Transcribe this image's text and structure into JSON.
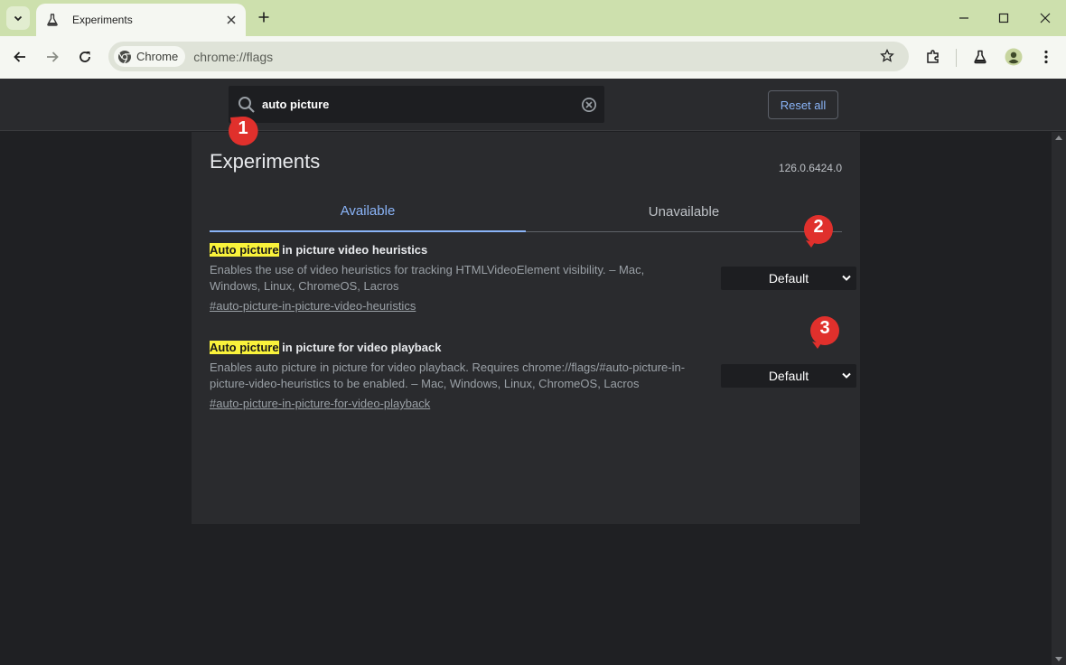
{
  "browser": {
    "tab_title": "Experiments",
    "chip_label": "Chrome",
    "url": "chrome://flags"
  },
  "flags_page": {
    "search_value": "auto picture",
    "reset_label": "Reset all",
    "title": "Experiments",
    "version": "126.0.6424.0",
    "tabs": [
      {
        "label": "Available",
        "active": true
      },
      {
        "label": "Unavailable",
        "active": false
      }
    ],
    "flags": [
      {
        "title_highlight": "Auto picture",
        "title_rest": " in picture video heuristics",
        "description": "Enables the use of video heuristics for tracking HTMLVideoElement visibility. – Mac, Windows, Linux, ChromeOS, Lacros",
        "link": "#auto-picture-in-picture-video-heuristics",
        "selected": "Default"
      },
      {
        "title_highlight": "Auto picture",
        "title_rest": " in picture for video playback",
        "description": "Enables auto picture in picture for video playback. Requires chrome://flags/#auto-picture-in-picture-video-heuristics to be enabled. – Mac, Windows, Linux, ChromeOS, Lacros",
        "link": "#auto-picture-in-picture-for-video-playback",
        "selected": "Default"
      }
    ]
  },
  "callouts": [
    "1",
    "2",
    "3"
  ],
  "colors": {
    "accent": "#8ab4f8",
    "highlight": "#f9f23b",
    "callout_red": "#e0302c",
    "titlebar": "#cde0ad"
  }
}
